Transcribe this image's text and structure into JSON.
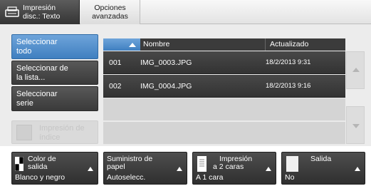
{
  "tabs": {
    "active_label_line1": "Impresión",
    "active_label_line2": "disc.: Texto",
    "inactive_label_line1": "Opciones",
    "inactive_label_line2": "avanzadas"
  },
  "left": {
    "select_all_line1": "Seleccionar",
    "select_all_line2": "todo",
    "select_list_line1": "Seleccionar de",
    "select_list_line2": "la lista...",
    "select_series_line1": "Seleccionar",
    "select_series_line2": "serie",
    "index_print_line1": "Impresión de",
    "index_print_line2": "índice"
  },
  "table": {
    "col_name": "Nombre",
    "col_date": "Actualizado",
    "rows": [
      {
        "num": "001",
        "name": "IMG_0003.JPG",
        "date": "18/2/2013 9:31"
      },
      {
        "num": "002",
        "name": "IMG_0004.JPG",
        "date": "18/2/2013 9:16"
      }
    ]
  },
  "bottom": {
    "color": {
      "line1": "Color de",
      "line2": "salida",
      "value": "Blanco y negro"
    },
    "paper": {
      "line1": "Suministro de",
      "line2": "papel",
      "value": "Autoselecc."
    },
    "duplex": {
      "line1": "Impresión",
      "line2": "a 2 caras",
      "value": "A 1 cara"
    },
    "output": {
      "line1": "Salida",
      "value": "No"
    }
  },
  "colors": {
    "accent": "#4a8ccd",
    "dark": "#3a3a3a"
  }
}
